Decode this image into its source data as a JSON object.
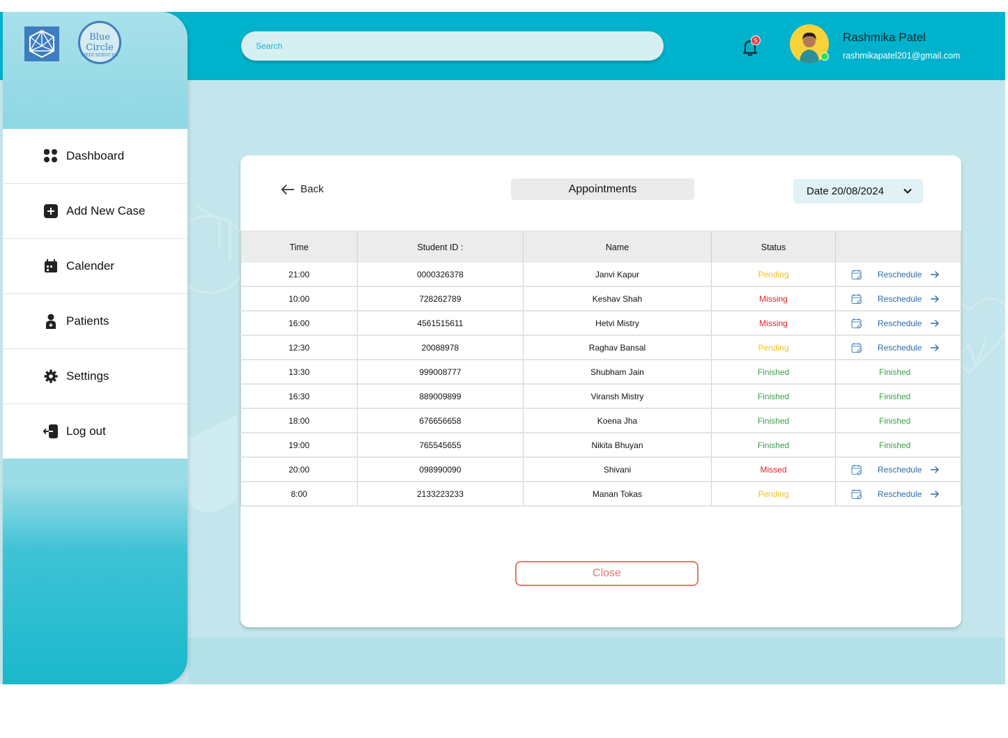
{
  "brand": {
    "logo_text_line1": "Blue",
    "logo_text_line2": "Circle",
    "logo_text_sub": "MEDI SERVICES"
  },
  "sidebar": {
    "items": [
      {
        "label": "Dashboard",
        "icon": "grid-icon"
      },
      {
        "label": "Add New  Case",
        "icon": "plus-square-icon"
      },
      {
        "label": "Calender",
        "icon": "calendar-icon"
      },
      {
        "label": "Patients",
        "icon": "person-icon"
      },
      {
        "label": "Settings",
        "icon": "gear-icon"
      },
      {
        "label": "Log out",
        "icon": "logout-icon"
      }
    ]
  },
  "header": {
    "search_placeholder": "Search",
    "notification_count": "5",
    "user_name": "Rashmika Patel",
    "user_email": "rashmikapatel201@gmail.com"
  },
  "card": {
    "back_label": "Back",
    "title": "Appointments",
    "date_label": "Date  20/08/2024",
    "close_label": "Close"
  },
  "table": {
    "columns": [
      "Time",
      "Student ID :",
      "Name",
      "Status",
      ""
    ],
    "rows": [
      {
        "time": "21:00",
        "id": "0000326378",
        "name": "Janvi Kapur",
        "status": "Pending",
        "action": "Reschedule"
      },
      {
        "time": "10:00",
        "id": "728262789",
        "name": "Keshav Shah",
        "status": "Missing",
        "action": "Reschedule"
      },
      {
        "time": "16:00",
        "id": "4561515611",
        "name": "Hetvi Mistry",
        "status": "Missing",
        "action": "Reschedule"
      },
      {
        "time": "12:30",
        "id": "20088978",
        "name": "Raghav Bansal",
        "status": "Pending",
        "action": "Reschedule"
      },
      {
        "time": "13:30",
        "id": "999008777",
        "name": "Shubham Jain",
        "status": "Finished",
        "action": "Finished"
      },
      {
        "time": "16:30",
        "id": "889009899",
        "name": "Viransh Mistry",
        "status": "Finished",
        "action": "Finished"
      },
      {
        "time": "18:00",
        "id": "676656658",
        "name": "Koena Jha",
        "status": "Finished",
        "action": "Finished"
      },
      {
        "time": "19:00",
        "id": "765545655",
        "name": "Nikita Bhuyan",
        "status": "Finished",
        "action": "Finished"
      },
      {
        "time": "20:00",
        "id": "098990090",
        "name": "Shivani",
        "status": "Missed",
        "action": "Reschedule"
      },
      {
        "time": "8:00",
        "id": "2133223233",
        "name": "Manan Tokas",
        "status": "Pending",
        "action": "Reschedule"
      }
    ]
  },
  "colors": {
    "header": "#00b2cb",
    "pending": "#f2c21b",
    "missing": "#e2222a",
    "finished": "#3aa04a",
    "reschedule": "#2a6ba8",
    "close": "#e8776a"
  }
}
